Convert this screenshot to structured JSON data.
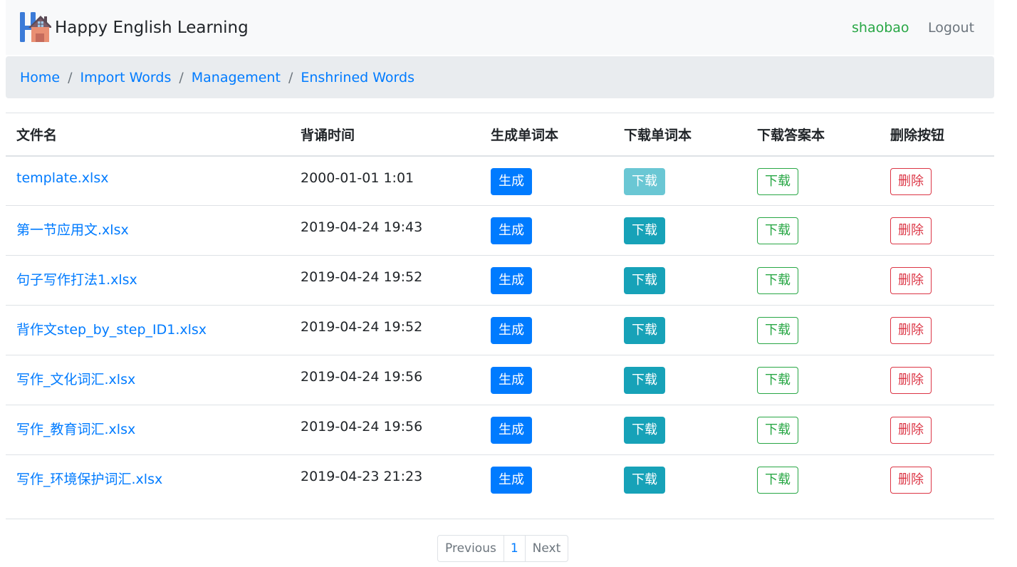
{
  "navbar": {
    "brand_text": "Happy English Learning",
    "user": "shaobao",
    "logout": "Logout"
  },
  "breadcrumb": [
    "Home",
    "Import Words",
    "Management",
    "Enshrined Words"
  ],
  "table": {
    "headers": [
      "文件名",
      "背诵时间",
      "生成单词本",
      "下载单词本",
      "下载答案本",
      "删除按钮"
    ],
    "rows": [
      {
        "file": "template.xlsx",
        "time": "2000-01-01 1:01",
        "generate": "生成",
        "download_words": "下载",
        "download_words_disabled": true,
        "download_answers": "下载",
        "delete": "删除"
      },
      {
        "file": "第一节应用文.xlsx",
        "time": "2019-04-24 19:43",
        "generate": "生成",
        "download_words": "下载",
        "download_words_disabled": false,
        "download_answers": "下载",
        "delete": "删除"
      },
      {
        "file": "句子写作打法1.xlsx",
        "time": "2019-04-24 19:52",
        "generate": "生成",
        "download_words": "下载",
        "download_words_disabled": false,
        "download_answers": "下载",
        "delete": "删除"
      },
      {
        "file": "背作文step_by_step_ID1.xlsx",
        "time": "2019-04-24 19:52",
        "generate": "生成",
        "download_words": "下载",
        "download_words_disabled": false,
        "download_answers": "下载",
        "delete": "删除"
      },
      {
        "file": "写作_文化词汇.xlsx",
        "time": "2019-04-24 19:56",
        "generate": "生成",
        "download_words": "下载",
        "download_words_disabled": false,
        "download_answers": "下载",
        "delete": "删除"
      },
      {
        "file": "写作_教育词汇.xlsx",
        "time": "2019-04-24 19:56",
        "generate": "生成",
        "download_words": "下载",
        "download_words_disabled": false,
        "download_answers": "下载",
        "delete": "删除"
      },
      {
        "file": "写作_环境保护词汇.xlsx",
        "time": "2019-04-23 21:23",
        "generate": "生成",
        "download_words": "下载",
        "download_words_disabled": false,
        "download_answers": "下载",
        "delete": "删除"
      }
    ]
  },
  "pagination": {
    "previous": "Previous",
    "current_page": "1",
    "next": "Next"
  },
  "colors": {
    "primary": "#007bff",
    "info": "#17a2b8",
    "success": "#28a745",
    "danger": "#dc3545",
    "navbar_bg": "#f8f9fa",
    "breadcrumb_bg": "#e9ecef"
  },
  "icons": {
    "brand_logo": "house-h-logo-icon"
  }
}
